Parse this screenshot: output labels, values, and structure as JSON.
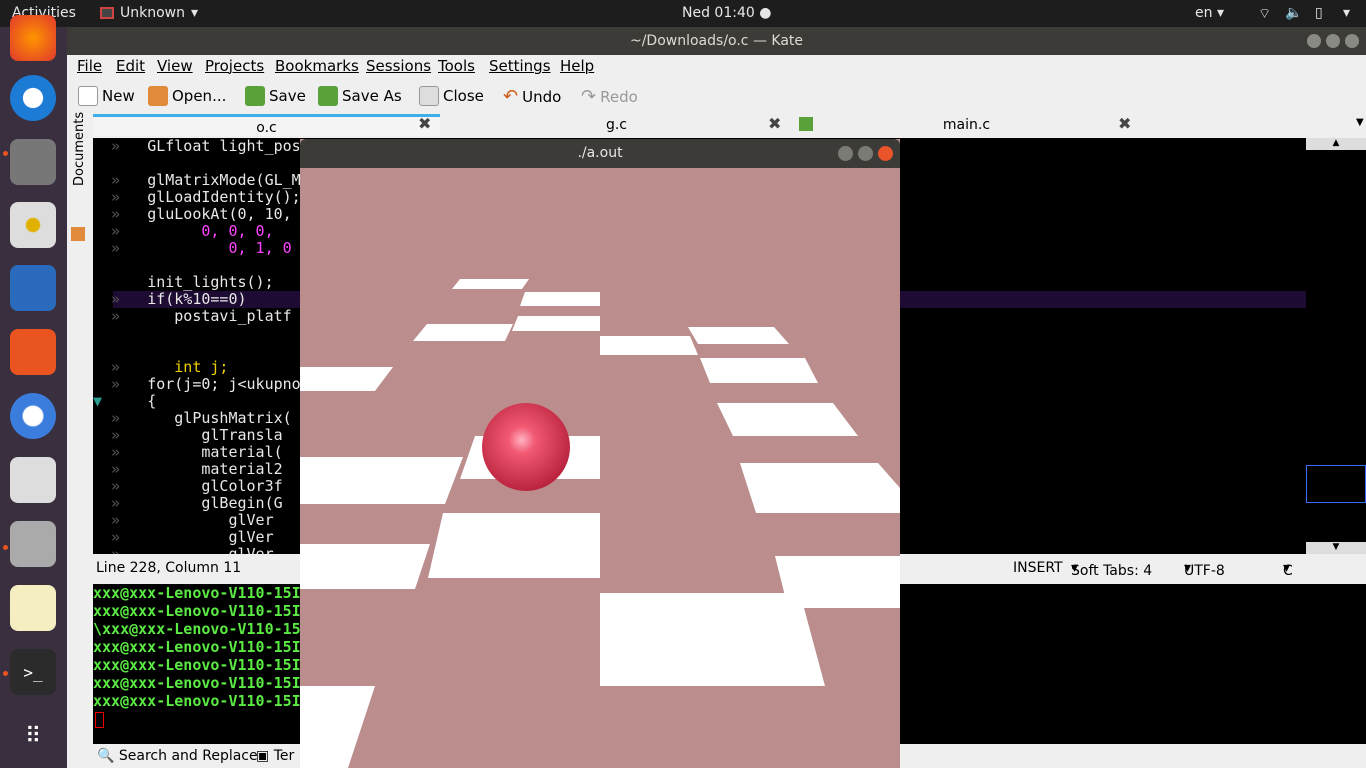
{
  "topbar": {
    "activities": "Activities",
    "app_menu": "Unknown",
    "clock": "Ned 01:40",
    "lang": "en"
  },
  "kate": {
    "title": "~/Downloads/o.c — Kate",
    "menu": [
      "File",
      "Edit",
      "View",
      "Projects",
      "Bookmarks",
      "Sessions",
      "Tools",
      "Settings",
      "Help"
    ],
    "toolbar": {
      "new": "New",
      "open": "Open...",
      "save": "Save",
      "save_as": "Save As",
      "close": "Close",
      "undo": "Undo",
      "redo": "Redo"
    },
    "tabs": [
      {
        "label": "o.c"
      },
      {
        "label": "g.c"
      },
      {
        "label": "main.c"
      }
    ],
    "sidebar_label": "Documents",
    "code": [
      "GLfloat light_pos",
      "",
      "glMatrixMode(GL_M",
      "glLoadIdentity();",
      "gluLookAt(0, 10,",
      "0, 0, 0,",
      "0, 1, 0",
      "",
      "init_lights();",
      "if(k%10==0)",
      "postavi_platf",
      "",
      "",
      "int j;",
      "for(j=0; j<ukupno",
      "{",
      "glPushMatrix(",
      "glTransla",
      "material(",
      "material2",
      "glColor3f",
      "glBegin(G",
      "glVer",
      "glVer",
      "glVer"
    ],
    "status": {
      "position": "Line 228, Column 11",
      "mode": "INSERT",
      "tabs": "Soft Tabs: 4",
      "encoding": "UTF-8",
      "syntax": "C"
    },
    "terminal_lines": [
      "xxx@xxx-Lenovo-V110-15I",
      "xxx@xxx-Lenovo-V110-15I",
      "\\xxx@xxx-Lenovo-V110-15",
      "xxx@xxx-Lenovo-V110-15I",
      "xxx@xxx-Lenovo-V110-15I",
      "xxx@xxx-Lenovo-V110-15I",
      "xxx@xxx-Lenovo-V110-15I"
    ],
    "bottom": {
      "search_replace": "Search and Replace",
      "terminal": "Ter"
    }
  },
  "glwindow": {
    "title": "./a.out",
    "background": "#bb8d8d",
    "ball_color": "#e8405a"
  }
}
